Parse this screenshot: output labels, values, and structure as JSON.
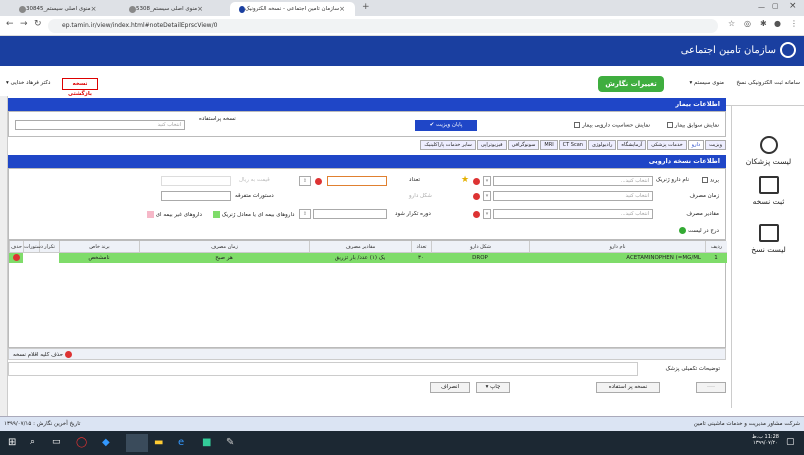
{
  "browser": {
    "tabs": [
      {
        "title": "سازمان تامین اجتماعی - نسخه الکترونیک",
        "active": true
      },
      {
        "title": "منوی اصلی سیستم_5308",
        "active": false
      },
      {
        "title": "منوی اصلی سیستم_30845",
        "active": false
      }
    ],
    "url": "ep.tamin.ir/view/index.html#noteDetailEprscView/0"
  },
  "header": {
    "logo_text": "سازمان تامین اجتماعی"
  },
  "subheader": {
    "breadcrumb": "سامانه ثبت الکترونیکی نسخ",
    "menu": "منوی سیستم ▾",
    "title_pill": "تغییرات نگارش",
    "doctor": "دکتر فرهاد خدایی ▾",
    "new_version": "نسخه بازگشتی"
  },
  "patient": {
    "title": "اطلاعات بیمار",
    "history_label": "نمایش سوابق بیمار",
    "allergy_label": "نمایش حساسیت دارویی بیمار",
    "end_visit": "پایان ویزیت",
    "usage_label": "نسخه پراستفاده",
    "select_placeholder": "انتخاب کنید"
  },
  "tabs": [
    "ویزیت",
    "دارو",
    "خدمات پزشکی",
    "آزمایشگاه",
    "رادیولوژی",
    "CT Scan",
    "MRI",
    "سونوگرافی",
    "فیزیوتراپی",
    "سایر خدمات پاراکلینیک"
  ],
  "prescription": {
    "title": "اطلاعات نسخه دارویی",
    "brand": "برند",
    "drug_name": "نام دارو ژنریک",
    "drug_placeholder": "انتخاب کنید...",
    "usage_time": "زمان مصرف",
    "usage_time_placeholder": "انتخاب کنید",
    "amount": "مقادیر مصرف",
    "amount_placeholder": "انتخاب کنید...",
    "count": "تعداد",
    "drug_form": "شکل دارو",
    "repeat": "دوره تکرار شود",
    "price_label": "قیمت به ریال",
    "instructions": "دستورات متفرقه",
    "legend_green": "داروهای بیمه ای یا معادل ژنریک",
    "legend_pink": "داروهای غیر بیمه ای",
    "add_to_list": "درج در لیست",
    "delete_all": "حذف کلیه اقلام نسخه",
    "doctor_notes": "توضیحات تکمیلی پزشک"
  },
  "table": {
    "headers": [
      "ردیف",
      "نام دارو",
      "شکل دارو",
      "تعداد",
      "مقادیر مصرف",
      "زمان مصرف",
      "برند خاص",
      "تکرار",
      "دستورات",
      "حذف"
    ],
    "rows": [
      {
        "row": "1",
        "name": "ACETAMINOPHEN (=MG/ML",
        "form": "DROP",
        "count": "۳۰",
        "amount": "یک (۱) عدد/ بار تزریق",
        "time": "هر صبح",
        "brand": "نامشخص"
      }
    ]
  },
  "actions": {
    "cancel": "انصراف",
    "print": "چاپ ▾",
    "frequent": "نسخه پر استفاده",
    "blank": "----"
  },
  "sidebar": {
    "items": [
      "لیست پزشکان",
      "ثبت نسخه",
      "لیست نسخ"
    ]
  },
  "footer": {
    "company": "شرکت مشاور مدیریت و خدمات ماشینی تامین",
    "last_edit": "تاریخ آخرین نگارش : ۱۳۹۹/۰۷/۱۵"
  },
  "taskbar": {
    "time": "11:28 ب.ظ",
    "date": "۱۳۹۹/۰۷/۲۰"
  },
  "colors": {
    "brand_blue": "#1a3fa0",
    "bar_blue": "#1f46c7",
    "row_green": "#7fdc6a",
    "pill_green": "#3fae3f"
  }
}
